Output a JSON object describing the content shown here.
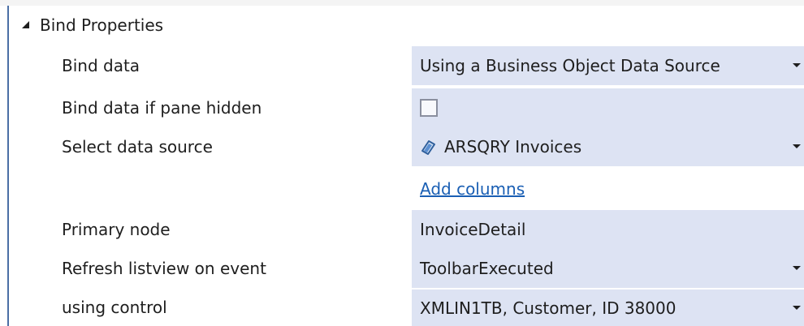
{
  "section": {
    "title": "Bind Properties",
    "expand_icon": "collapse-triangle-icon"
  },
  "rows": [
    {
      "label": "Bind data",
      "value": "Using a Business Object Data Source",
      "control": "dropdown"
    },
    {
      "label": "Bind data if pane hidden",
      "checked": false,
      "control": "checkbox"
    },
    {
      "label": "Select data source",
      "value": "ARSQRY Invoices",
      "icon": "data-source-icon",
      "control": "dropdown"
    },
    {
      "label": "",
      "link_text": "Add columns",
      "control": "link"
    },
    {
      "label": "Primary node",
      "value": "InvoiceDetail",
      "control": "text"
    },
    {
      "label": "Refresh listview on event",
      "value": "ToolbarExecuted",
      "control": "dropdown"
    },
    {
      "label": "using control",
      "value": "XMLIN1TB, Customer, ID 38000",
      "control": "dropdown"
    }
  ],
  "colors": {
    "value_background": "#dde3f3",
    "link": "#1a5fb4",
    "text": "#1e1e1e",
    "accent_bar": "#4a6fa5"
  }
}
